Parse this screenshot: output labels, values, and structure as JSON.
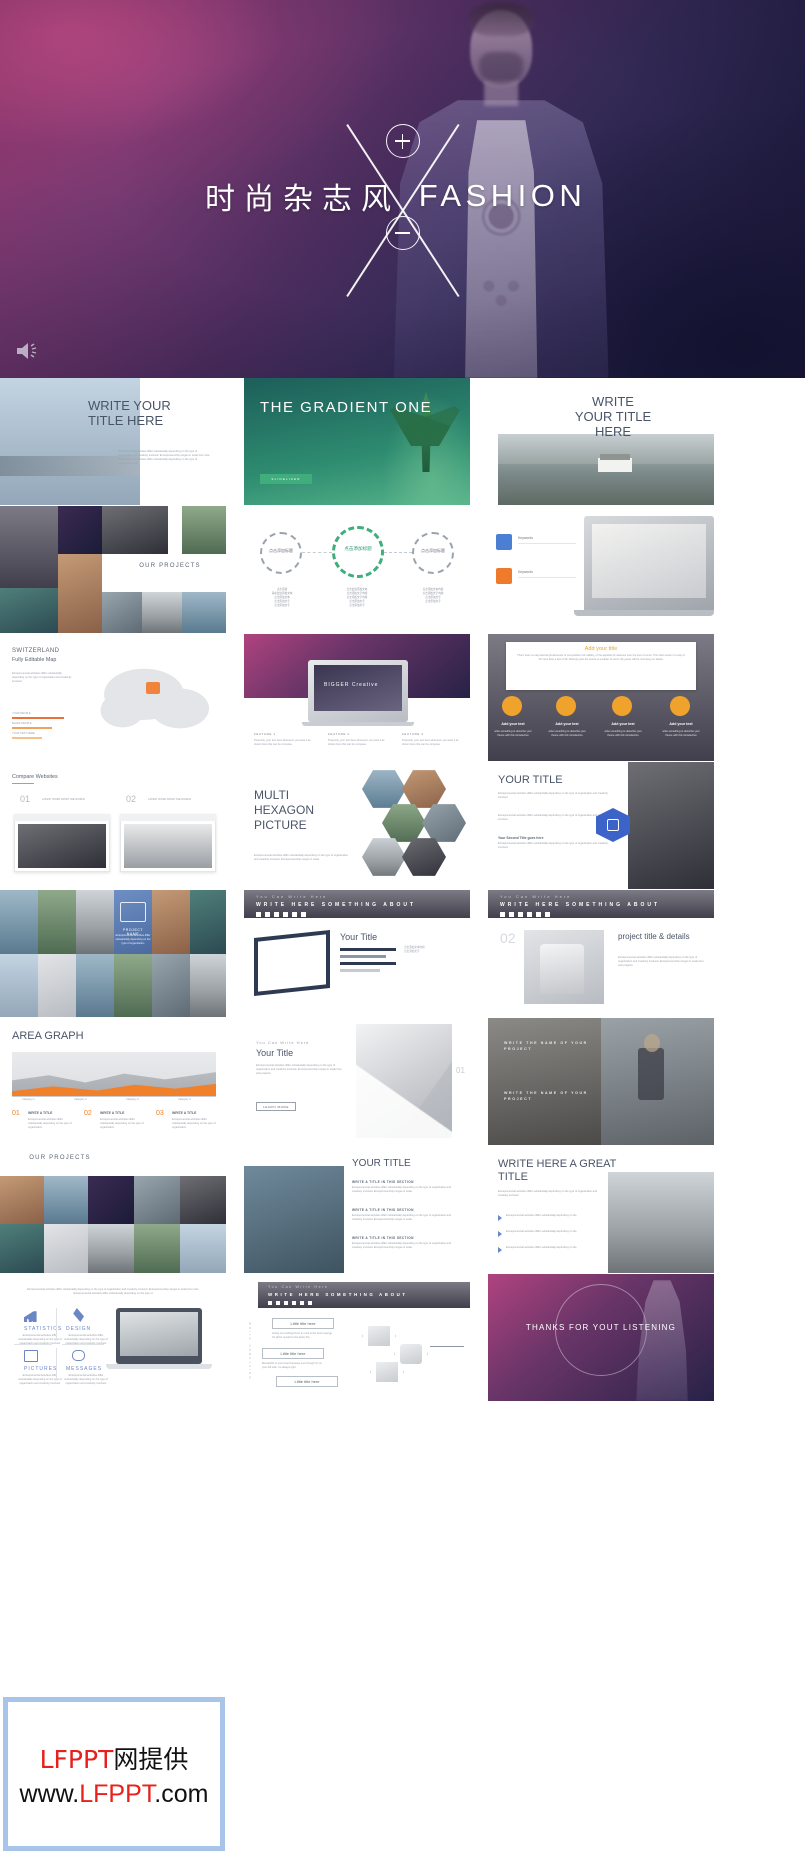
{
  "hero": {
    "title_cn": "时尚杂志风",
    "title_en": "FASHION",
    "plus_icon": "plus-circle-icon",
    "minus_icon": "minus-circle-icon",
    "x_mark": "x-cross-graphic",
    "sound_icon": "speaker-icon",
    "colors": {
      "gradient_start": "#b0437f",
      "gradient_mid": "#4c2d5e",
      "gradient_end": "#141531"
    }
  },
  "slides": [
    {
      "id": 1,
      "row": 1,
      "col": 1,
      "title": "WRITE\nYOUR TITLE\nHERE",
      "body": "Entrepreneurial activities differ substantially depending on the type of organization and creativity involved. Entrepreneurship ranges in scale from solo, Entrepreneurial activities differ substantially depending on the type of organization and"
    },
    {
      "id": 2,
      "row": 1,
      "col": 2,
      "title": "THE GRADIENT ONE",
      "subtitle": "SLIDELIZER"
    },
    {
      "id": 3,
      "row": 1,
      "col": 3,
      "title": "WRITE\nYOUR TITLE\nHERE"
    },
    {
      "id": 4,
      "row": 2,
      "col": 1,
      "title": "OUR PROJECTS"
    },
    {
      "id": 5,
      "row": 2,
      "col": 2,
      "title": "点击添加标题",
      "items": [
        "点击添加\n请在此处添加文本\n点击添加文本\n点击添加文字\n点击添加文字",
        "点击此处添加文本\n点击添加文字内容\n点击添加文字内容\n点击添加文字\n点击添加文字",
        "点击添加文本内容\n点击添加文字内容\n点击添加文字\n点击添加文字"
      ]
    },
    {
      "id": 6,
      "row": 2,
      "col": 3,
      "title": "Keywords",
      "cards": [
        "Keywords",
        "Keywords"
      ]
    },
    {
      "id": 7,
      "row": 3,
      "col": 1,
      "title": "SWITZERLAND",
      "subtitle": "Fully Editable Map",
      "legend": [
        "YOUR PEOPLE",
        "BLUES PEOPLE",
        "YOUR TEXT HERE"
      ]
    },
    {
      "id": 8,
      "row": 3,
      "col": 2,
      "title": "BIGGER Creative",
      "captions": [
        "FEATURE 1",
        "FEATURE 2",
        "FEATURE 3"
      ],
      "body": "Presently, your text here whenever you want it as shown here this can be compose."
    },
    {
      "id": 9,
      "row": 3,
      "col": 3,
      "title": "Add your title",
      "body": "That's been a real potential predecessor of composition risk validity, of the appetite for advance over the love of sums. This often exists in a way of 60 more than a few of 30. Nobody grew the words to a leader of sums. My guess will be mounting our ideals.",
      "items": [
        "Add your text",
        "Add your text",
        "Add your text",
        "Add your text"
      ]
    },
    {
      "id": 10,
      "row": 4,
      "col": 1,
      "title": "Compare Websites",
      "nums": [
        "01",
        "02"
      ],
      "labels": [
        "LATEST WORK FROM THE WORLD",
        "LATEST WORK FROM THE WORLD"
      ]
    },
    {
      "id": 11,
      "row": 4,
      "col": 2,
      "title": "MULTI HEXAGON PICTURE"
    },
    {
      "id": 12,
      "row": 4,
      "col": 3,
      "title": "YOUR TITLE",
      "sub1": "Your Second Title goes here",
      "body": "Entrepreneurial activities differ substantially depending on the type of organization and creativity involved."
    },
    {
      "id": 13,
      "row": 5,
      "col": 1,
      "title": "PROJECT NAME",
      "body": "Entrepreneurial activities differ substantially depending on the type of organization"
    },
    {
      "id": 14,
      "row": 5,
      "col": 2,
      "title": "Your Title",
      "header": "You Can Write Here",
      "band": "WRITE HERE SOMETHING ABOUT"
    },
    {
      "id": 15,
      "row": 5,
      "col": 3,
      "title": "project title & details",
      "header": "You Can Write Here",
      "band": "WRITE HERE SOMETHING ABOUT",
      "num": "02"
    },
    {
      "id": 16,
      "row": 6,
      "col": 1,
      "title": "AREA GRAPH",
      "nums": [
        "01",
        "02",
        "03"
      ],
      "labels": [
        "WRITE A TITLE",
        "WRITE A TITLE",
        "WRITE A TITLE"
      ]
    },
    {
      "id": 17,
      "row": 6,
      "col": 2,
      "title": "Your Title",
      "header": "You Can Write Here",
      "button": "LEARN MORE",
      "num": "01"
    },
    {
      "id": 18,
      "row": 6,
      "col": 3,
      "title": "WRITE THE NAME OF YOUR PROJECT",
      "title2": "WRITE THE NAME OF YOUR PROJECT"
    },
    {
      "id": 19,
      "row": 7,
      "col": 1,
      "title": "OUR PROJECTS"
    },
    {
      "id": 20,
      "row": 7,
      "col": 2,
      "title": "YOUR TITLE",
      "sections": [
        "WRITE A TITLE IN THIS SECTION",
        "WRITE A TITLE IN THIS SECTION",
        "WRITE A TITLE IN THIS SECTION"
      ]
    },
    {
      "id": 21,
      "row": 7,
      "col": 3,
      "title": "WRITE HERE A GREAT TITLE",
      "body": "Entrepreneurial activities differ substantially depending on the type of organization and creativity involved",
      "bullets": [
        "Entrepreneurial activities differ substantially depending on the",
        "Entrepreneurial activities differ substantially depending on the",
        "Entrepreneurial activities differ substantially depending on the"
      ]
    },
    {
      "id": 22,
      "row": 8,
      "col": 1,
      "body": "Entrepreneurial activities differ substantially depending on the type of organization and creativity involved. Entrepreneurship ranges in scale from solo. Entrepreneurial activities differ substantially depending on the type of",
      "items": [
        "STATISTICS",
        "DESIGN",
        "PICTURES",
        "MESSAGES"
      ]
    },
    {
      "id": 23,
      "row": 8,
      "col": 2,
      "header": "You Can Write Here",
      "band": "WRITE HERE SOMETHING ABOUT",
      "side": "WRITE SOMETHING",
      "cards": [
        "Little title here",
        "Little title here",
        "Little title here"
      ]
    },
    {
      "id": 24,
      "row": 8,
      "col": 3,
      "title": "THANKS FOR YOUT LISTENING"
    }
  ],
  "watermark": {
    "line1_red": "LFPPT",
    "line1_black": "网提供",
    "line2_pre": "www.",
    "line2_red": "LFPPT",
    "line2_post": ".com",
    "border_color": "#a8c4e8",
    "red": "#e8201c"
  }
}
